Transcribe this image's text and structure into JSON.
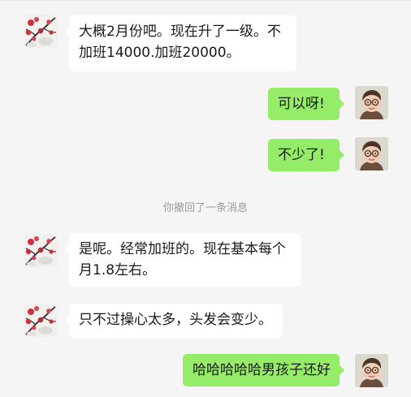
{
  "chat": {
    "messages": [
      {
        "side": "left",
        "lines": [
          "大概2月份吧。现在升了一级。不",
          "加班14000.加班20000。"
        ]
      },
      {
        "side": "right",
        "lines": [
          "可以呀!"
        ]
      },
      {
        "side": "right",
        "lines": [
          "不少了!"
        ]
      },
      {
        "side": "left",
        "lines": [
          "是呢。经常加班的。现在基本每个",
          "月1.8左右。"
        ]
      },
      {
        "side": "left",
        "lines": [
          "只不过操心太多，头发会变少。"
        ]
      },
      {
        "side": "right",
        "lines": [
          "哈哈哈哈哈男孩子还好"
        ]
      }
    ],
    "system_notice": "你撤回了一条消息"
  },
  "avatars": {
    "contact": {
      "icon": "plum-blossom-avatar-icon"
    },
    "self": {
      "icon": "child-portrait-avatar-icon"
    }
  },
  "colors": {
    "background": "#f5f5f5",
    "incoming_bubble": "#ffffff",
    "outgoing_bubble": "#95ec69",
    "system_text": "#9b9b9b"
  }
}
